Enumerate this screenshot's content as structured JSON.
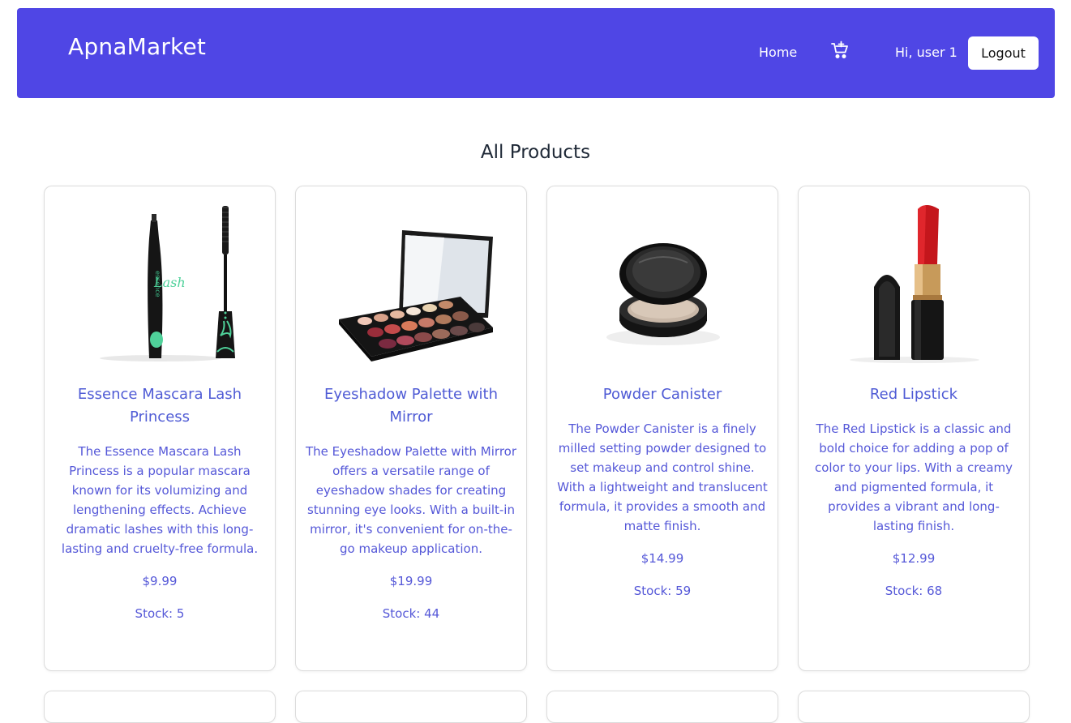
{
  "header": {
    "brand": "ApnaMarket",
    "home_label": "Home",
    "cart_icon": "cart-icon",
    "greeting": "Hi, user 1",
    "logout_label": "Logout",
    "accent_color": "#4f46e5"
  },
  "main": {
    "heading": "All Products",
    "products": [
      {
        "name": "Essence Mascara Lash Princess",
        "description": "The Essence Mascara Lash Princess is a popular mascara known for its volumizing and lengthening effects. Achieve dramatic lashes with this long-lasting and cruelty-free formula.",
        "price": "$9.99",
        "stock": "Stock: 5",
        "image_icon": "mascara-image"
      },
      {
        "name": "Eyeshadow Palette with Mirror",
        "description": "The Eyeshadow Palette with Mirror offers a versatile range of eyeshadow shades for creating stunning eye looks. With a built-in mirror, it's convenient for on-the-go makeup application.",
        "price": "$19.99",
        "stock": "Stock: 44",
        "image_icon": "eyeshadow-palette-image"
      },
      {
        "name": "Powder Canister",
        "description": "The Powder Canister is a finely milled setting powder designed to set makeup and control shine. With a lightweight and translucent formula, it provides a smooth and matte finish.",
        "price": "$14.99",
        "stock": "Stock: 59",
        "image_icon": "powder-canister-image"
      },
      {
        "name": "Red Lipstick",
        "description": "The Red Lipstick is a classic and bold choice for adding a pop of color to your lips. With a creamy and pigmented formula, it provides a vibrant and long-lasting finish.",
        "price": "$12.99",
        "stock": "Stock: 68",
        "image_icon": "lipstick-image"
      }
    ]
  }
}
